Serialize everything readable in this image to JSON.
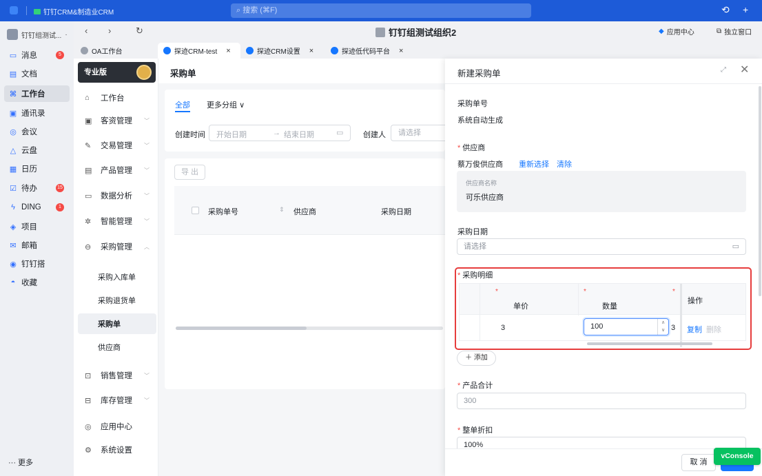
{
  "topbar": {
    "app_title": "钉钉CRM&制造业CRM",
    "search_placeholder": "搜索 (⌘F)",
    "history_icon": "history-icon",
    "add_icon": "plus-icon"
  },
  "sidebar": {
    "org_name": "钉钉组测试...",
    "items": [
      {
        "label": "消息",
        "icon": "message-icon",
        "badge": "5"
      },
      {
        "label": "文档",
        "icon": "doc-icon",
        "badge": ""
      },
      {
        "label": "工作台",
        "icon": "workbench-icon",
        "badge": ""
      },
      {
        "label": "通讯录",
        "icon": "contacts-icon",
        "badge": ""
      },
      {
        "label": "会议",
        "icon": "meeting-icon",
        "badge": ""
      },
      {
        "label": "云盘",
        "icon": "cloud-icon",
        "badge": ""
      },
      {
        "label": "日历",
        "icon": "calendar-icon",
        "badge": ""
      },
      {
        "label": "待办",
        "icon": "todo-icon",
        "badge": "15"
      },
      {
        "label": "DING",
        "icon": "ding-icon",
        "badge": "1"
      },
      {
        "label": "项目",
        "icon": "project-icon",
        "badge": ""
      },
      {
        "label": "邮箱",
        "icon": "mail-icon",
        "badge": ""
      },
      {
        "label": "钉钉搭",
        "icon": "builder-icon",
        "badge": ""
      },
      {
        "label": "收藏",
        "icon": "favorite-icon",
        "badge": ""
      }
    ],
    "more_label": "··· 更多"
  },
  "window": {
    "title": "钉钉组测试组织2",
    "app_center": "应用中心",
    "standalone": "独立窗口"
  },
  "tabs": [
    {
      "label": "OA工作台",
      "close": ""
    },
    {
      "label": "探迹CRM-test",
      "close": "×"
    },
    {
      "label": "探迹CRM设置",
      "close": "×"
    },
    {
      "label": "探迹低代码平台",
      "close": "×"
    }
  ],
  "appnav": {
    "badge": "专业版",
    "menus": [
      {
        "label": "工作台",
        "chev": ""
      },
      {
        "label": "客资管理",
        "chev": "﹀"
      },
      {
        "label": "交易管理",
        "chev": "﹀"
      },
      {
        "label": "产品管理",
        "chev": "﹀"
      },
      {
        "label": "数据分析",
        "chev": "﹀"
      },
      {
        "label": "智能管理",
        "chev": "﹀"
      },
      {
        "label": "采购管理",
        "chev": "︿"
      }
    ],
    "submenus": [
      "采购入库单",
      "采购退货单",
      "采购单",
      "供应商"
    ],
    "menus2": [
      {
        "label": "销售管理",
        "chev": "﹀"
      },
      {
        "label": "库存管理",
        "chev": "﹀"
      },
      {
        "label": "应用中心",
        "chev": ""
      },
      {
        "label": "系统设置",
        "chev": ""
      }
    ]
  },
  "page": {
    "title": "采购单",
    "filter_tabs": [
      "全部",
      "更多分组"
    ],
    "created_time_label": "创建时间",
    "start_date": "开始日期",
    "end_date": "结束日期",
    "creator_label": "创建人",
    "creator_placeholder": "请选择",
    "export": "导 出",
    "columns": [
      "采购单号",
      "供应商",
      "采购日期"
    ]
  },
  "drawer": {
    "title": "新建采购单",
    "order_no_label": "采购单号",
    "order_no_value": "系统自动生成",
    "supplier_label": "供应商",
    "supplier_value": "蔡万俊供应商",
    "reselect": "重新选择",
    "clear": "清除",
    "supplier_name_label": "供应商名称",
    "supplier_name_value": "可乐供应商",
    "date_label": "采购日期",
    "date_placeholder": "请选择",
    "detail_label": "采购明细",
    "detail_columns": {
      "price": "单价",
      "qty": "数量",
      "ops": "操作",
      "extra": "3"
    },
    "detail_row": {
      "price": "3",
      "qty": "100",
      "copy": "复制",
      "delete": "删除"
    },
    "add": "添加",
    "total_label": "产品合计",
    "total_value": "300",
    "discount_label": "整单折扣",
    "discount_value": "100%",
    "cancel": "取 消",
    "vconsole": "vConsole"
  },
  "colors": {
    "primary": "#1677ff",
    "topbar": "#1d5bd8",
    "danger": "#e63c3c",
    "vconsole": "#07c160"
  }
}
